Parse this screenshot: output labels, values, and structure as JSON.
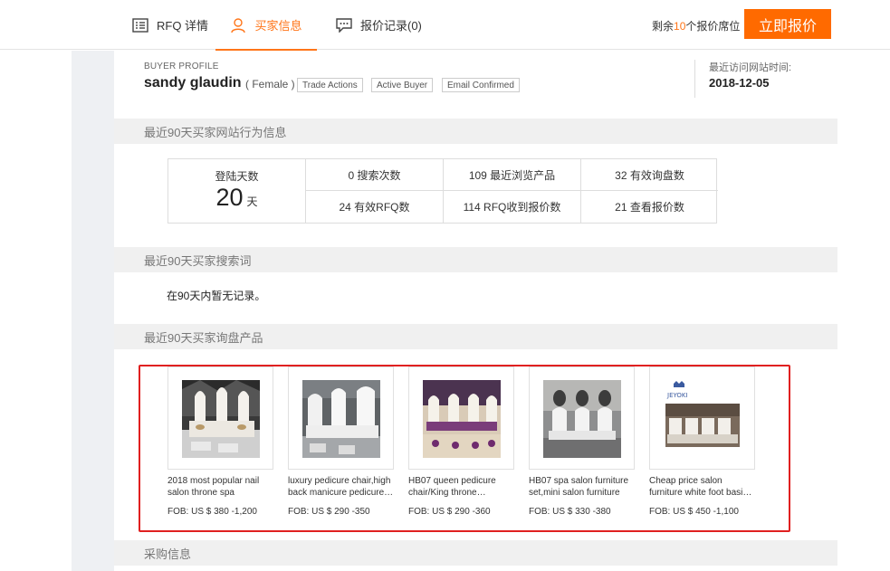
{
  "tabs": [
    {
      "label": "RFQ 详情",
      "icon": "document-list-icon"
    },
    {
      "label": "买家信息",
      "icon": "user-icon"
    },
    {
      "label": "报价记录(0)",
      "icon": "chat-quote-icon"
    }
  ],
  "seats": {
    "prefix": "剩余",
    "count": "10",
    "suffix": "个报价席位"
  },
  "quote_button": "立即报价",
  "profile": {
    "caption": "BUYER PROFILE",
    "name": "sandy glaudin",
    "gender": "( Female )",
    "tags": [
      "Trade Actions",
      "Active Buyer",
      "Email Confirmed"
    ],
    "last_visit_label": "最近访问网站时间:",
    "last_visit_date": "2018-12-05"
  },
  "sections": {
    "behavior": "最近90天买家网站行为信息",
    "search_terms": "最近90天买家搜索词",
    "inquired_products": "最近90天买家询盘产品",
    "purchase": "采购信息"
  },
  "stats": {
    "login_label": "登陆天数",
    "login_days": "20",
    "login_unit": "天",
    "cells": [
      "0 搜索次数",
      "109 最近浏览产品",
      "32 有效询盘数",
      "24 有效RFQ数",
      "114 RFQ收到报价数",
      "21 查看报价数"
    ]
  },
  "search_terms_empty": "在90天内暂无记录。",
  "products": [
    {
      "title": "2018 most popular nail salon throne spa pedicur…",
      "price": "FOB: US $ 380 -1,200"
    },
    {
      "title": "luxury pedicure chair,high back manicure pedicure…",
      "price": "FOB: US $ 290 -350"
    },
    {
      "title": "HB07 queen pedicure chair/King throne…",
      "price": "FOB: US $ 290 -360"
    },
    {
      "title": "HB07 spa salon furniture set,mini salon furniture",
      "price": "FOB: US $ 330 -380"
    },
    {
      "title": "Cheap price salon furniture white foot basi…",
      "price": "FOB: US $ 450 -1,100"
    }
  ],
  "product_logo_text": "JEYOKI",
  "colors": {
    "accent": "#ff7519",
    "button": "#ff6a00",
    "highlight_border": "#e02020"
  }
}
